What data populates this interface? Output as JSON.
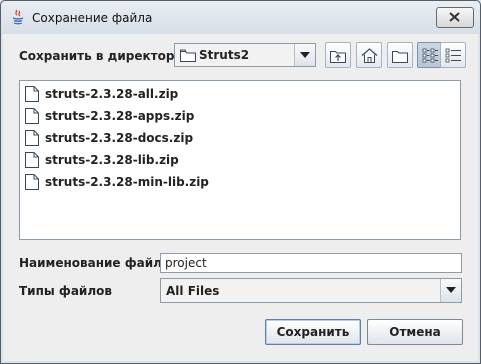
{
  "window": {
    "title": "Сохранение файла"
  },
  "toolbar": {
    "dir_label": "Сохранить в директории",
    "current_dir": "Struts2"
  },
  "files": [
    {
      "name": "struts-2.3.28-all.zip"
    },
    {
      "name": "struts-2.3.28-apps.zip"
    },
    {
      "name": "struts-2.3.28-docs.zip"
    },
    {
      "name": "struts-2.3.28-lib.zip"
    },
    {
      "name": "struts-2.3.28-min-lib.zip"
    }
  ],
  "filename": {
    "label": "Наименование файла",
    "value": "project"
  },
  "filetype": {
    "label": "Типы файлов",
    "selected": "All Files"
  },
  "buttons": {
    "save": "Сохранить",
    "cancel": "Отмена"
  },
  "colors": {
    "accent": "#3f6aa1",
    "window_bg": "#eeeeee"
  }
}
